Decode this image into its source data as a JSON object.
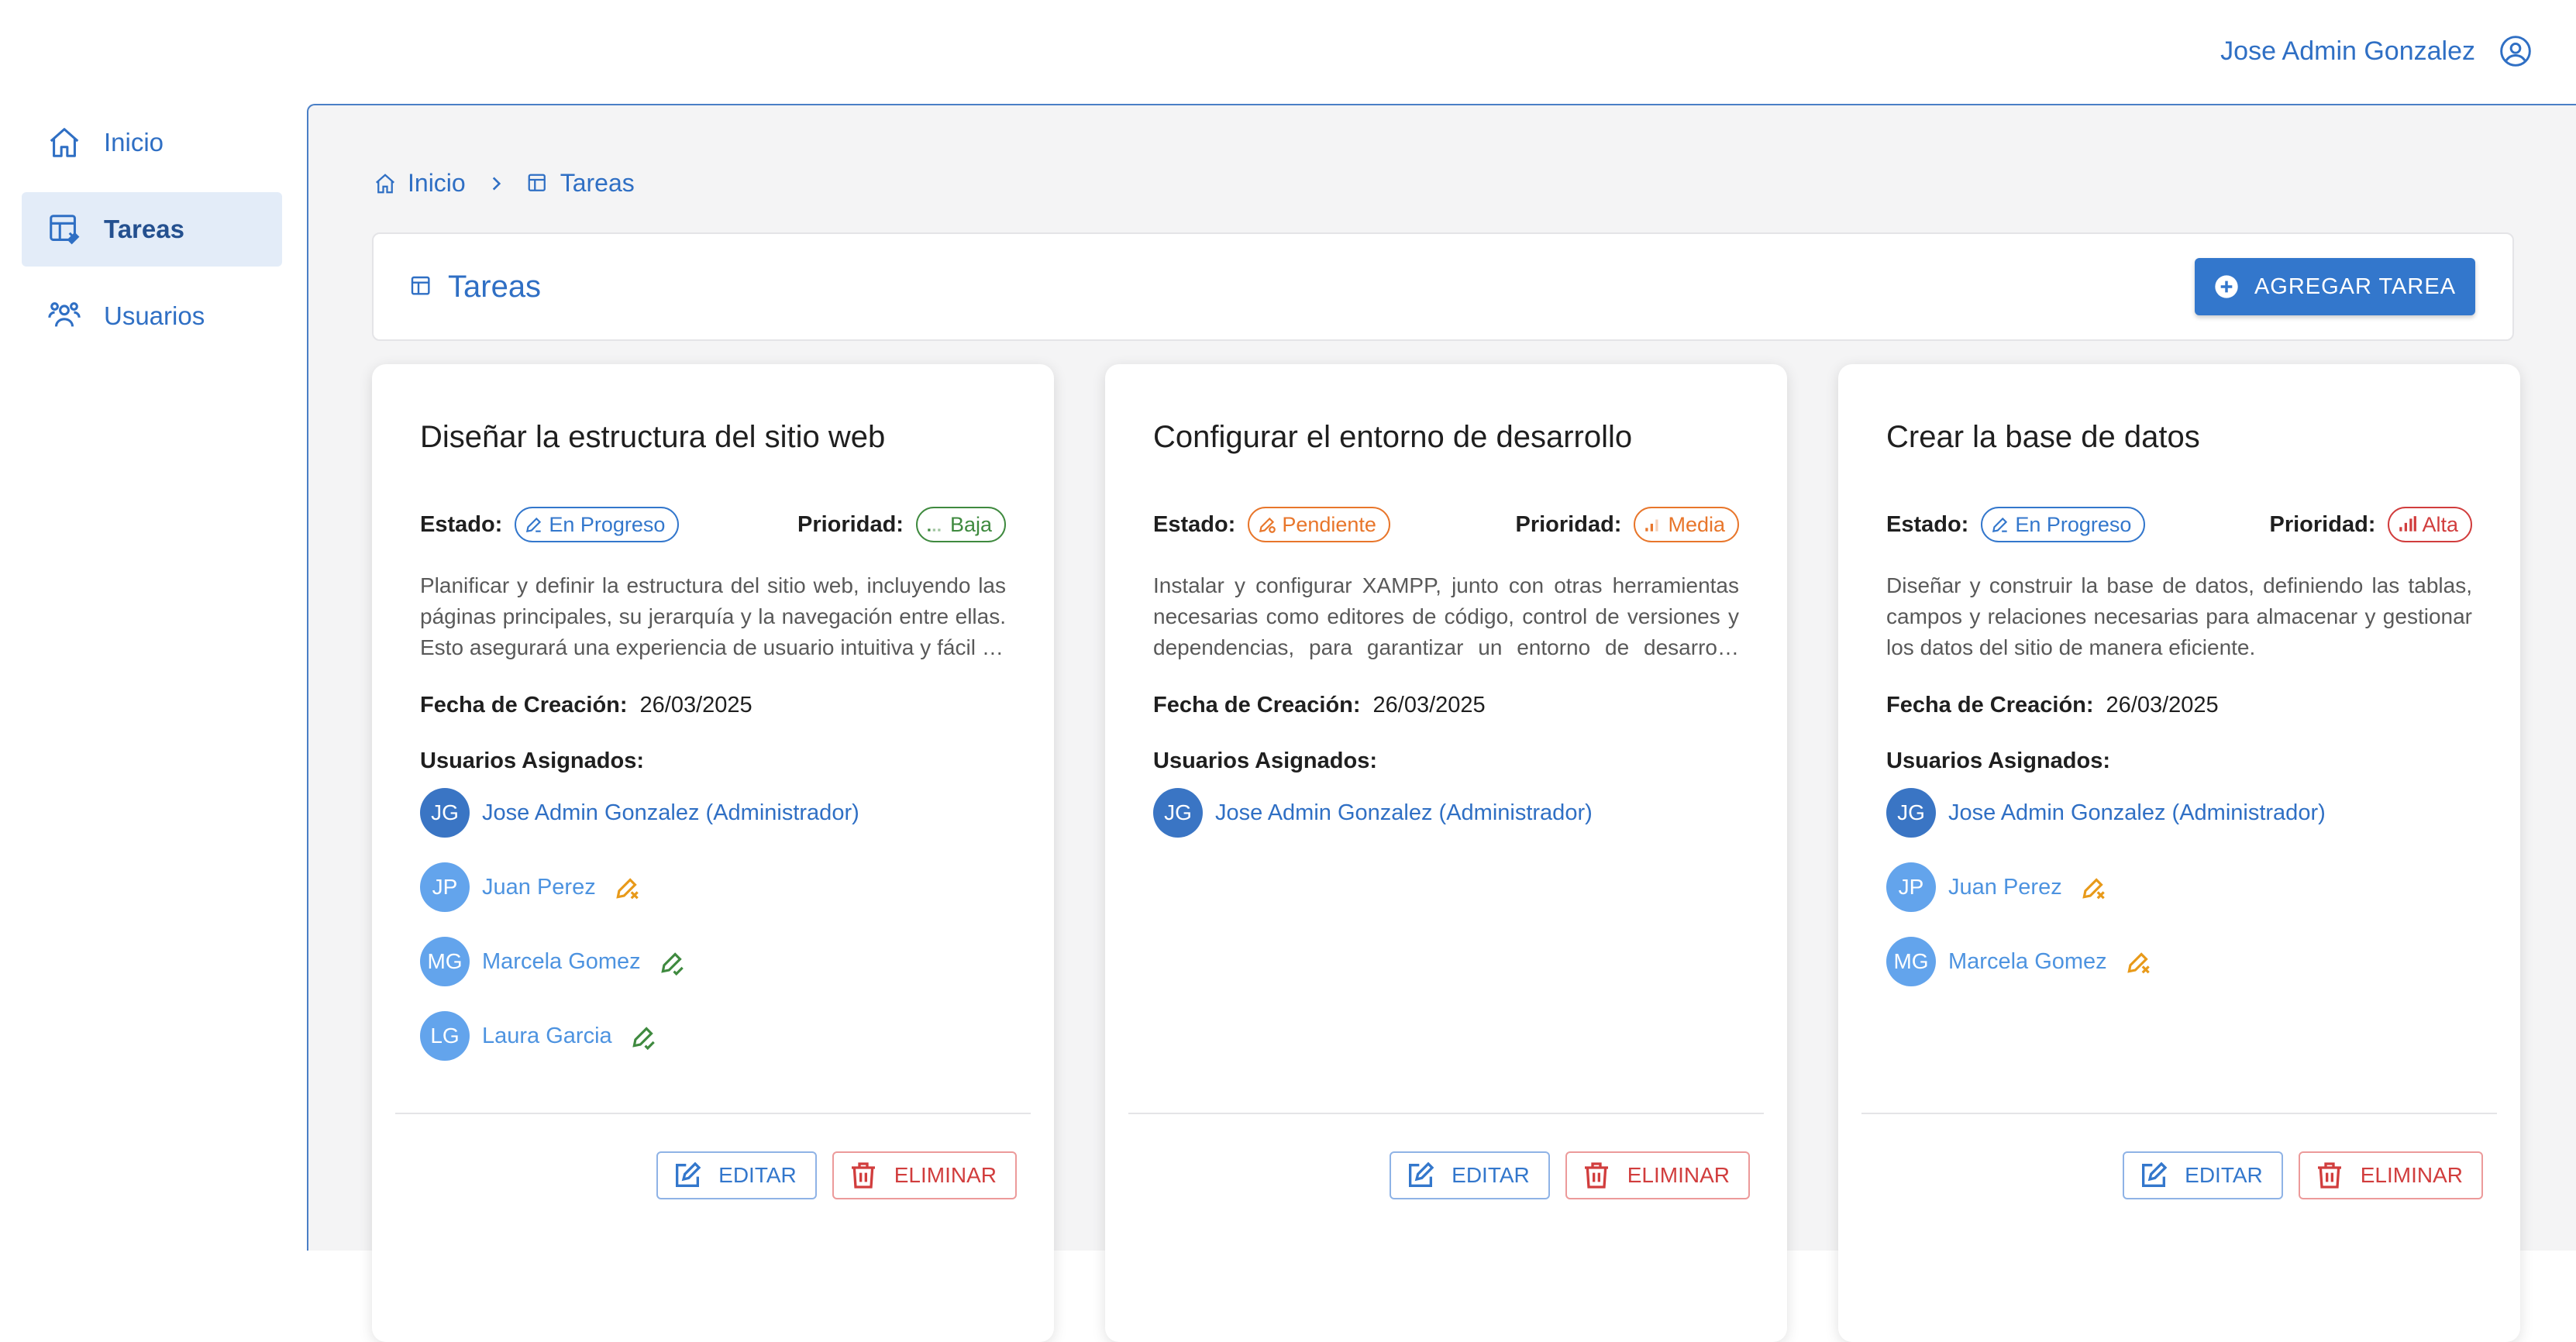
{
  "topbar": {
    "user_name": "Jose Admin Gonzalez",
    "user_icon": "account-circle-icon"
  },
  "sidebar": {
    "items": [
      {
        "label": "Inicio",
        "icon": "home-icon",
        "active": false
      },
      {
        "label": "Tareas",
        "icon": "table-edit-icon",
        "active": true
      },
      {
        "label": "Usuarios",
        "icon": "users-icon",
        "active": false
      }
    ]
  },
  "breadcrumb": {
    "items": [
      {
        "label": "Inicio"
      },
      {
        "label": "Tareas"
      }
    ]
  },
  "header": {
    "title": "Tareas",
    "add_label": "AGREGAR TAREA"
  },
  "labels": {
    "estado": "Estado:",
    "prioridad": "Prioridad:",
    "fecha": "Fecha de Creación:",
    "usuarios": "Usuarios Asignados:",
    "edit": "EDITAR",
    "delete": "ELIMINAR"
  },
  "colors": {
    "primary": "#3377cc",
    "danger": "#d13d3d",
    "avatar_admin": "#3a75c4",
    "avatar_user": "#63a4ec",
    "in_progress": "#3377cc",
    "pending": "#e8762b",
    "low": "#3f8a3f",
    "medium": "#e8762b",
    "high": "#d13d3d"
  },
  "tasks": [
    {
      "title": "Diseñar la estructura del sitio web",
      "status": "En Progreso",
      "priority": "Baja",
      "description": "Planificar y definir la estructura del sitio web, incluyendo las páginas principales, su jerarquía y la navegación entre ellas. Esto asegurará una experiencia de usuario intuitiva y fácil de usar.",
      "created": "26/03/2025",
      "users": [
        {
          "initials": "JG",
          "name": "Jose Admin Gonzalez (Administrador)",
          "perm": "none"
        },
        {
          "initials": "JP",
          "name": "Juan Perez",
          "perm": "no-edit"
        },
        {
          "initials": "MG",
          "name": "Marcela Gomez",
          "perm": "edit"
        },
        {
          "initials": "LG",
          "name": "Laura Garcia",
          "perm": "edit"
        }
      ]
    },
    {
      "title": "Configurar el entorno de desarrollo",
      "status": "Pendiente",
      "priority": "Media",
      "description": "Instalar y configurar XAMPP, junto con otras herramientas necesarias como editores de código, control de versiones y dependencias, para garantizar un entorno de desarrollo adecuado.",
      "created": "26/03/2025",
      "users": [
        {
          "initials": "JG",
          "name": "Jose Admin Gonzalez (Administrador)",
          "perm": "none"
        }
      ]
    },
    {
      "title": "Crear la base de datos",
      "status": "En Progreso",
      "priority": "Alta",
      "description": "Diseñar y construir la base de datos, definiendo las tablas, campos y relaciones necesarias para almacenar y gestionar los datos del sitio de manera eficiente.",
      "created": "26/03/2025",
      "users": [
        {
          "initials": "JG",
          "name": "Jose Admin Gonzalez (Administrador)",
          "perm": "none"
        },
        {
          "initials": "JP",
          "name": "Juan Perez",
          "perm": "no-edit"
        },
        {
          "initials": "MG",
          "name": "Marcela Gomez",
          "perm": "no-edit"
        }
      ]
    }
  ]
}
